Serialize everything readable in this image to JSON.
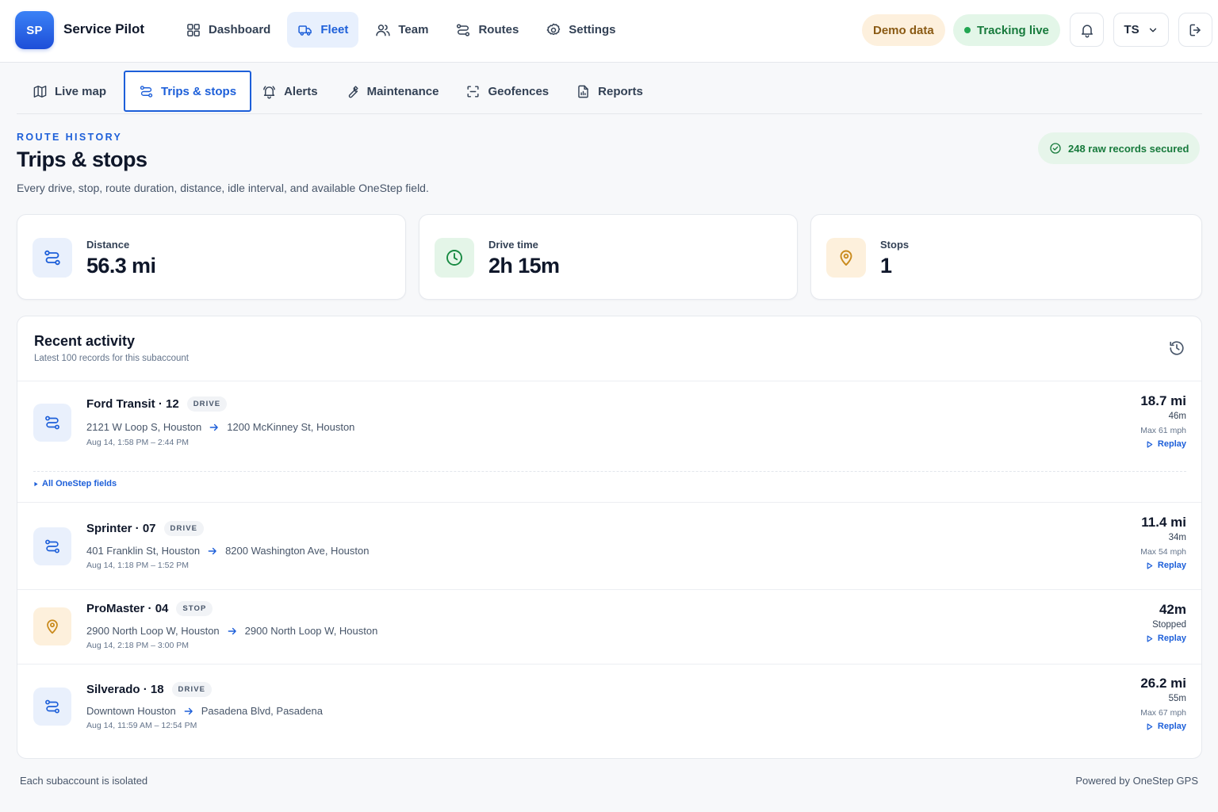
{
  "app": {
    "logo_initials": "SP",
    "name": "Service Pilot"
  },
  "nav": {
    "items": [
      {
        "label": "Dashboard",
        "icon": "grid-icon"
      },
      {
        "label": "Fleet",
        "icon": "truck-icon",
        "active": true
      },
      {
        "label": "Team",
        "icon": "users-icon"
      },
      {
        "label": "Routes",
        "icon": "route-icon"
      },
      {
        "label": "Settings",
        "icon": "gear-icon"
      }
    ]
  },
  "header": {
    "demo_label": "Demo data",
    "tracking_label": "Tracking live",
    "user_initials": "TS"
  },
  "subnav": {
    "tabs": [
      {
        "label": "Live map",
        "icon": "map-icon"
      },
      {
        "label": "Trips & stops",
        "icon": "route-icon",
        "active": true
      },
      {
        "label": "Alerts",
        "icon": "bell-icon"
      },
      {
        "label": "Maintenance",
        "icon": "wrench-icon"
      },
      {
        "label": "Geofences",
        "icon": "geofence-icon"
      },
      {
        "label": "Reports",
        "icon": "report-icon"
      }
    ]
  },
  "page": {
    "eyebrow": "ROUTE HISTORY",
    "title": "Trips & stops",
    "subtitle": "Every drive, stop, route duration, distance, idle interval, and available OneStep field.",
    "records_badge": "248 raw records secured"
  },
  "stats": [
    {
      "label": "Distance",
      "value": "56.3 mi",
      "icon": "route-icon"
    },
    {
      "label": "Drive time",
      "value": "2h 15m",
      "icon": "clock-icon"
    },
    {
      "label": "Stops",
      "value": "1",
      "icon": "pin-icon"
    }
  ],
  "activity": {
    "title": "Recent activity",
    "subtitle": "Latest 100 records for this subaccount",
    "fields_link": "All OneStep fields",
    "replay_label": "Replay",
    "rows": [
      {
        "vehicle": "Ford Transit · 12",
        "tag": "DRIVE",
        "from": "2121 W Loop S, Houston",
        "to": "1200 McKinney St, Houston",
        "time": "Aug 14, 1:58 PM – 2:44 PM",
        "main": "18.7 mi",
        "sub": "46m",
        "speed": "Max 61 mph"
      },
      {
        "vehicle": "Sprinter · 07",
        "tag": "DRIVE",
        "from": "401 Franklin St, Houston",
        "to": "8200 Washington Ave, Houston",
        "time": "Aug 14, 1:18 PM – 1:52 PM",
        "main": "11.4 mi",
        "sub": "34m",
        "speed": "Max 54 mph"
      },
      {
        "vehicle": "ProMaster · 04",
        "tag": "STOP",
        "from": "2900 North Loop W, Houston",
        "to": "2900 North Loop W, Houston",
        "time": "Aug 14, 2:18 PM – 3:00 PM",
        "main": "42m",
        "sub": "Stopped"
      },
      {
        "vehicle": "Silverado · 18",
        "tag": "DRIVE",
        "from": "Downtown Houston",
        "to": "Pasadena Blvd, Pasadena",
        "time": "Aug 14, 11:59 AM – 12:54 PM",
        "main": "26.2 mi",
        "sub": "55m",
        "speed": "Max 67 mph"
      }
    ]
  },
  "footer": {
    "left": "Each subaccount is isolated",
    "right": "Powered by OneStep GPS"
  },
  "colors": {
    "accent": "#1d5fd9",
    "live_green": "#177a3c",
    "demo_amber": "#8a5a14",
    "stop_amber": "#c98a1c"
  }
}
